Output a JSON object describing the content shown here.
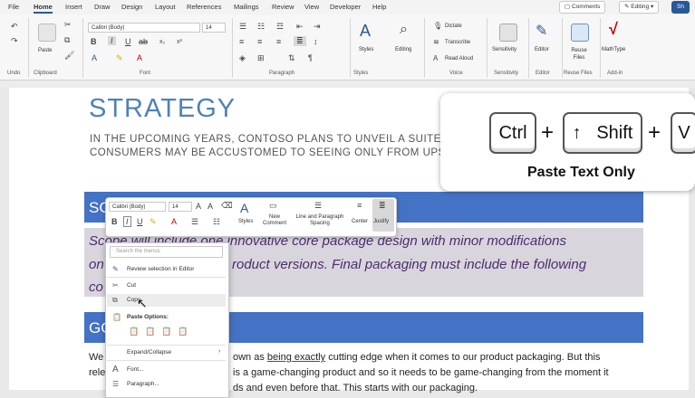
{
  "menubar": {
    "tabs": [
      "File",
      "Home",
      "Insert",
      "Draw",
      "Design",
      "Layout",
      "References",
      "Mailings",
      "Review",
      "View",
      "Developer",
      "Help"
    ],
    "comments_label": "Comments",
    "editing_label": "Editing",
    "share_label": "Sh"
  },
  "ribbon": {
    "groups": {
      "undo": "Undo",
      "clipboard": "Clipboard",
      "font": "Font",
      "paragraph": "Paragraph",
      "styles": "Styles",
      "voice": "Voice",
      "sensitivity": "Sensitivity",
      "editor": "Editor",
      "reuse_files": "Reuse Files",
      "addin": "Add-in"
    },
    "paste_label": "Paste",
    "font_name": "Calibri (Body)",
    "font_size": "14",
    "styles_label": "Styles",
    "editing_label": "Editing",
    "dictate_label": "Dictate",
    "transcribe_label": "Transcribe",
    "read_aloud_label": "Read Aloud",
    "sensitivity_label": "Sensitivity",
    "editor_label": "Editor",
    "reuse_files_label": "Reuse Files",
    "mathtype_label": "MathType"
  },
  "document": {
    "title": "STRATEGY",
    "line1": "IN THE UPCOMING YEARS, CONTOSO PLANS TO UNVEIL A SUITE OF HIGH",
    "line2": "CONSUMERS MAY BE ACCUSTOMED TO SEEING ONLY FROM UPSCALE EL",
    "band1_text": "SC",
    "italic1": "Scope will include one innovative core package design with minor modifications",
    "italic2": "roduct versions. Final packaging must include the following",
    "italic2_prefix": "on",
    "italic3_prefix": "co",
    "band2_text": "GO",
    "body1_pre": "own as ",
    "body1_link": "being exactly",
    "body1_post": " cutting edge when it comes to our product packaging. But this",
    "body1_prefix": "We",
    "body2": "is a game-changing product and so it needs to be game-changing from the moment it",
    "body2_prefix": "rele",
    "body3": "ds and even before that. This starts with our packaging."
  },
  "shortcut": {
    "ctrl": "Ctrl",
    "shift": "Shift",
    "v": "V",
    "caption": "Paste Text Only"
  },
  "mini_toolbar": {
    "font_name": "Calibri (Body)",
    "font_size": "14",
    "styles": "Styles",
    "new_comment": "New Comment",
    "line_spacing": "Line and Paragraph Spacing",
    "center": "Center",
    "justify": "Justify"
  },
  "context_menu": {
    "search_placeholder": "Search the menus",
    "review": "Review selection in Editor",
    "cut": "Cut",
    "copy": "Copy",
    "paste_options": "Paste Options:",
    "expand_collapse": "Expand/Collapse",
    "font": "Font...",
    "paragraph": "Paragraph..."
  }
}
